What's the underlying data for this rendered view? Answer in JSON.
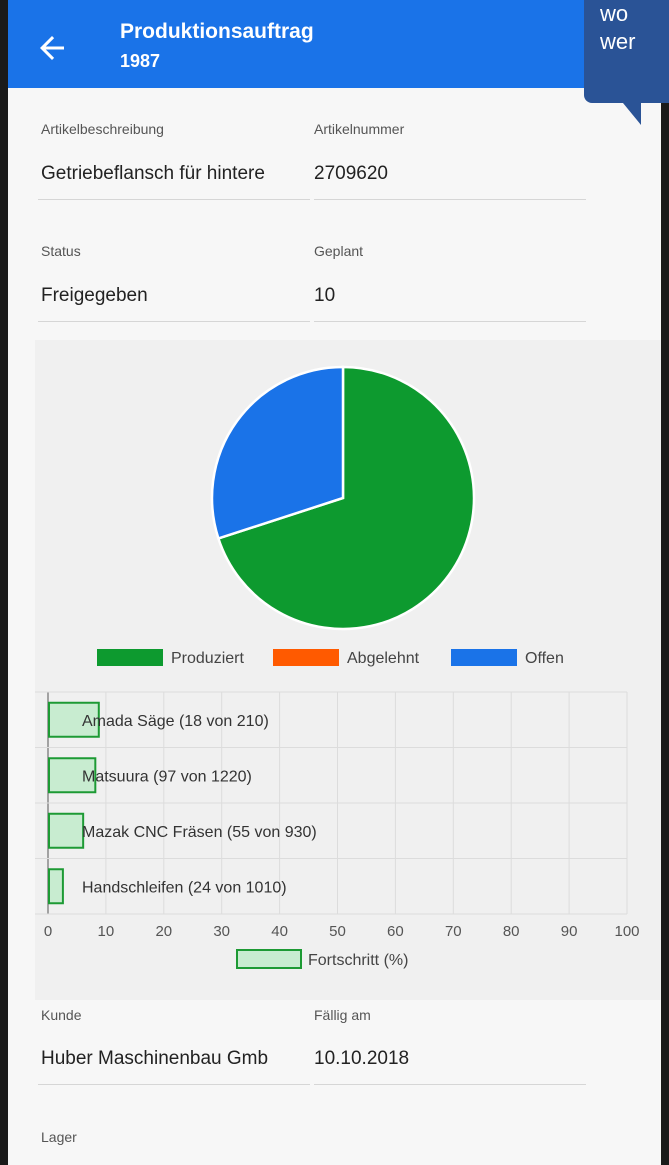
{
  "header": {
    "title": "Produktionsauftrag",
    "subtitle": "1987"
  },
  "tooltip": {
    "line1": "wo",
    "line2": "wer"
  },
  "fields": {
    "artikelbeschreibung": {
      "label": "Artikelbeschreibung",
      "value": "Getriebeflansch für hintere"
    },
    "artikelnummer": {
      "label": "Artikelnummer",
      "value": "2709620"
    },
    "status": {
      "label": "Status",
      "value": "Freigegeben"
    },
    "geplant": {
      "label": "Geplant",
      "value": "10"
    },
    "kunde": {
      "label": "Kunde",
      "value": "Huber Maschinenbau Gmb"
    },
    "faellig": {
      "label": "Fällig am",
      "value": "10.10.2018"
    },
    "lager": {
      "label": "Lager"
    }
  },
  "colors": {
    "appbar": "#1a73e8",
    "produziert": "#0d9a2f",
    "abgelehnt": "#ff5a00",
    "offen": "#1a73e8",
    "bar_fill": "#c8ecd0",
    "bar_stroke": "#1d9a34"
  },
  "chart_data": [
    {
      "type": "pie",
      "legend": [
        "Produziert",
        "Abgelehnt",
        "Offen"
      ],
      "values": [
        7,
        0,
        3
      ],
      "legend_position": "bottom"
    },
    {
      "type": "bar",
      "orientation": "horizontal",
      "categories": [
        "Amada Säge (18 von 210)",
        "Matsuura (97 von 1220)",
        "Mazak CNC Fräsen (55 von 930)",
        "Handschleifen (24 von 1010)"
      ],
      "series": [
        {
          "name": "Fortschritt (%)",
          "values": [
            8.6,
            8.0,
            5.9,
            2.4
          ]
        }
      ],
      "xlim": [
        0,
        100
      ],
      "xticks": [
        "0",
        "10",
        "20",
        "30",
        "40",
        "50",
        "60",
        "70",
        "80",
        "90",
        "100"
      ],
      "grid": true,
      "legend_position": "bottom"
    }
  ]
}
